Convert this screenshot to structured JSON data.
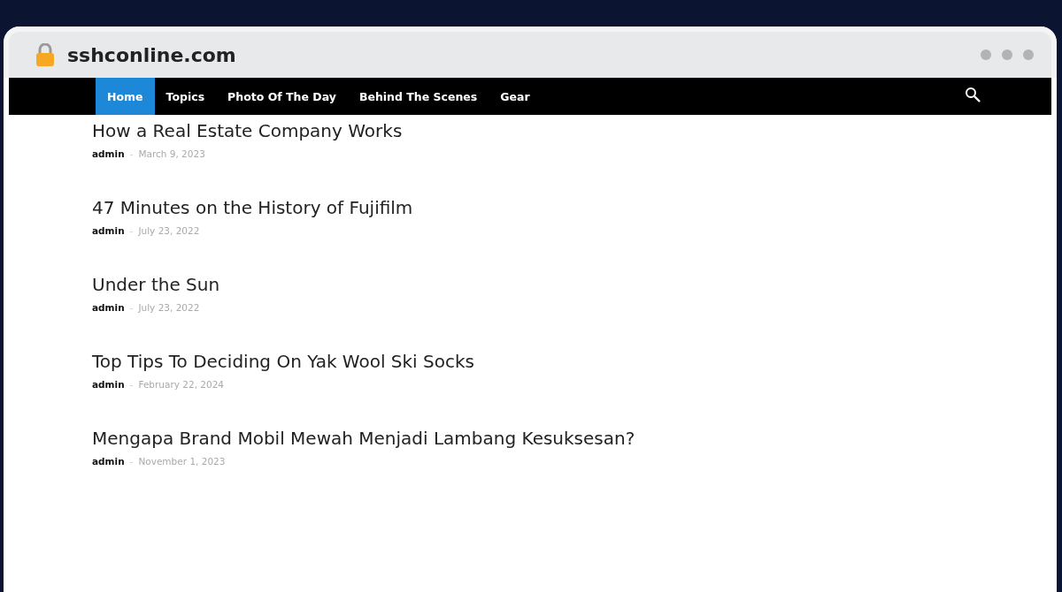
{
  "browser": {
    "address": "sshconline.com"
  },
  "nav": {
    "items": [
      {
        "label": "Home",
        "selected": true
      },
      {
        "label": "Topics",
        "selected": false
      },
      {
        "label": "Photo Of The Day",
        "selected": false
      },
      {
        "label": "Behind The Scenes",
        "selected": false
      },
      {
        "label": "Gear",
        "selected": false
      }
    ]
  },
  "posts": [
    {
      "title": "How a Real Estate Company Works",
      "author": "admin",
      "separator": "-",
      "date": "March 9, 2023"
    },
    {
      "title": "47 Minutes on the History of Fujifilm",
      "author": "admin",
      "separator": "-",
      "date": "July 23, 2022"
    },
    {
      "title": "Under the Sun",
      "author": "admin",
      "separator": "-",
      "date": "July 23, 2022"
    },
    {
      "title": "Top Tips To Deciding On Yak Wool Ski Socks",
      "author": "admin",
      "separator": "-",
      "date": "February 22, 2024"
    },
    {
      "title": "Mengapa Brand Mobil Mewah Menjadi Lambang Kesuksesan?",
      "author": "admin",
      "separator": "-",
      "date": "November 1, 2023"
    }
  ]
}
